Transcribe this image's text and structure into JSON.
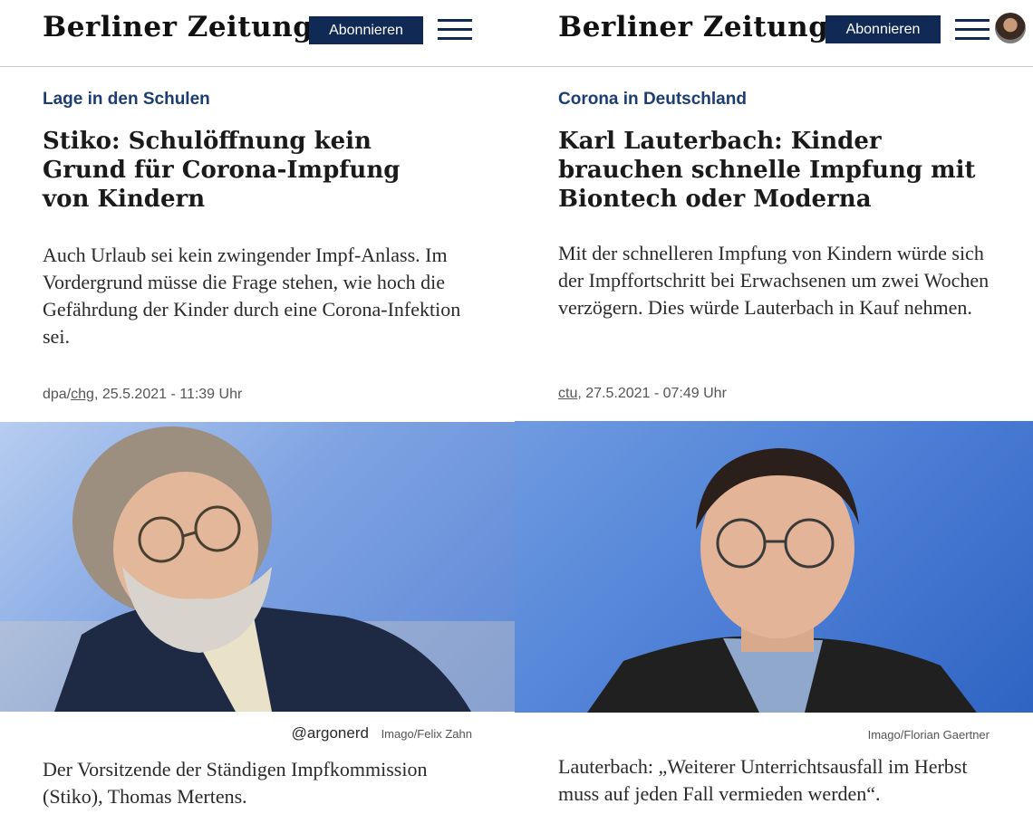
{
  "left": {
    "logo": "Berliner Zeitung",
    "subscribe_label": "Abonnieren",
    "menu_icon": "hamburger-menu-icon",
    "kicker": "Lage in den Schulen",
    "headline": "Stiko: Schulöffnung kein Grund für Corona-Impfung von Kindern",
    "teaser": "Auch Urlaub sei kein zwingender Impf-Anlass. Im Vordergrund müsse die Frage stehen, wie hoch die Gefährdung der Kinder durch eine Corona-Infektion sei.",
    "meta_prefix": "dpa/",
    "meta_author": "chg",
    "meta_date": ", 25.5.2021 - 11:39 Uhr",
    "photo_desc": "Foto",
    "watermark": "@argonerd",
    "credit": "Imago/Felix Zahn",
    "caption": "Der Vorsitzende der Ständigen Impfkommission (Stiko), Thomas Mertens."
  },
  "right": {
    "logo": "Berliner Zeitung",
    "subscribe_label": "Abonnieren",
    "menu_icon": "hamburger-menu-icon",
    "kicker": "Corona in Deutschland",
    "headline": "Karl Lauterbach: Kinder brauchen schnelle Impfung mit Biontech oder Moderna",
    "teaser": "Mit der schnelleren Impfung von Kindern würde sich der Impffortschritt bei Erwachsenen um zwei Wochen verzögern. Dies würde Lauterbach in Kauf nehmen.",
    "meta_author": "ctu",
    "meta_date": ", 27.5.2021 - 07:49 Uhr",
    "credit": "Imago/Florian Gaertner",
    "caption": "Lauterbach: „Weiterer Unterrichtsausfall im Herbst muss auf jeden Fall vermieden werden“."
  },
  "colors": {
    "brand_navy": "#102a55",
    "kicker_blue": "#1c3d72"
  }
}
